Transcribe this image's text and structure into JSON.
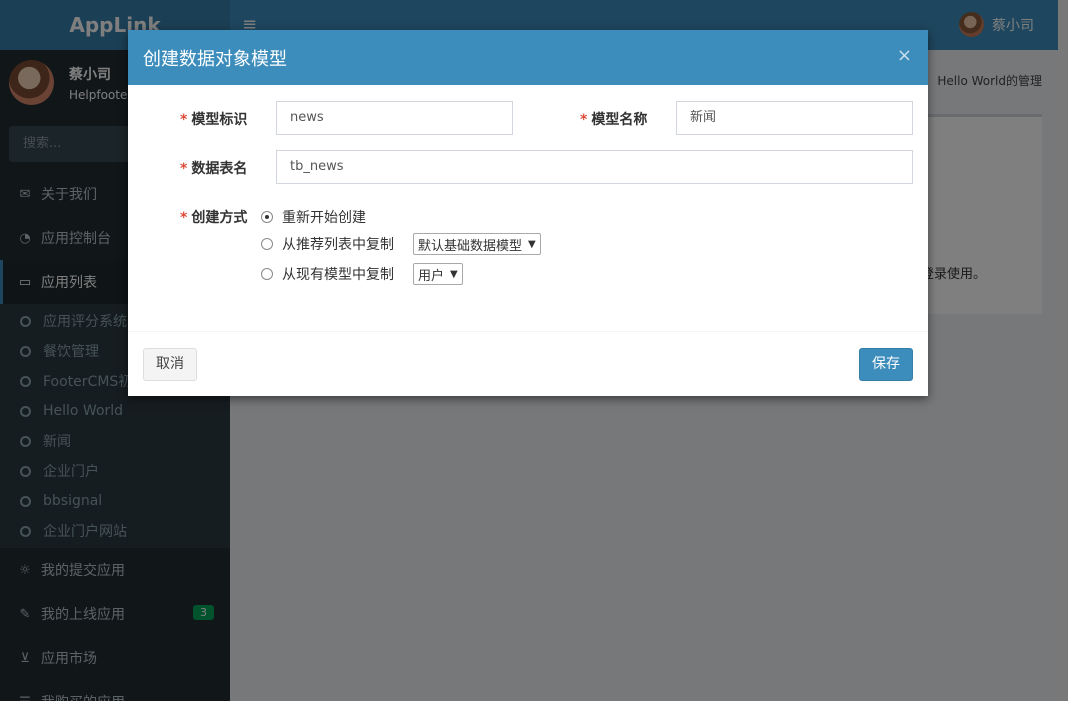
{
  "topbar": {
    "logo": "AppLink",
    "menu_icon": "hamburger-icon",
    "user_name": "蔡小司"
  },
  "sidebar": {
    "user_name": "蔡小司",
    "user_sub": "Helpfooter",
    "search_placeholder": "搜索...",
    "items": [
      {
        "label": "关于我们",
        "icon": "envelope-icon"
      },
      {
        "label": "应用控制台",
        "icon": "dashboard-icon"
      },
      {
        "label": "应用列表",
        "icon": "laptop-icon"
      }
    ],
    "subitems": [
      "应用评分系统",
      "餐饮管理",
      "FooterCMS初",
      "Hello World",
      "新闻",
      "企业门户",
      "bbsignal",
      "企业门户网站"
    ],
    "items_bottom": [
      {
        "label": "我的提交应用",
        "icon": "bulb-icon"
      },
      {
        "label": "我的上线应用",
        "icon": "wrench-icon",
        "badge": "3"
      },
      {
        "label": "应用市场",
        "icon": "cart-icon"
      },
      {
        "label": "我购买的应用",
        "icon": "list-icon"
      }
    ]
  },
  "content": {
    "breadcrumb": "Hello World的管理",
    "box_text": "登录使用。"
  },
  "modal": {
    "title": "创建数据对象模型",
    "close": "×",
    "fields": {
      "model_id_label": "模型标识",
      "model_id_value": "news",
      "model_name_label": "模型名称",
      "model_name_value": "新闻",
      "table_name_label": "数据表名",
      "table_name_value": "tb_news",
      "create_mode_label": "创建方式",
      "required_mark": "*"
    },
    "create_options": [
      {
        "label": "重新开始创建",
        "checked": true
      },
      {
        "label": "从推荐列表中复制",
        "select": "默认基础数据模型"
      },
      {
        "label": "从现有模型中复制",
        "select": "用户"
      }
    ],
    "cancel_label": "取消",
    "save_label": "保存"
  },
  "colors": {
    "primary": "#3c8dbc",
    "sidebar_bg": "#222d32",
    "required": "#dd4b39",
    "badge": "#00a65a"
  }
}
